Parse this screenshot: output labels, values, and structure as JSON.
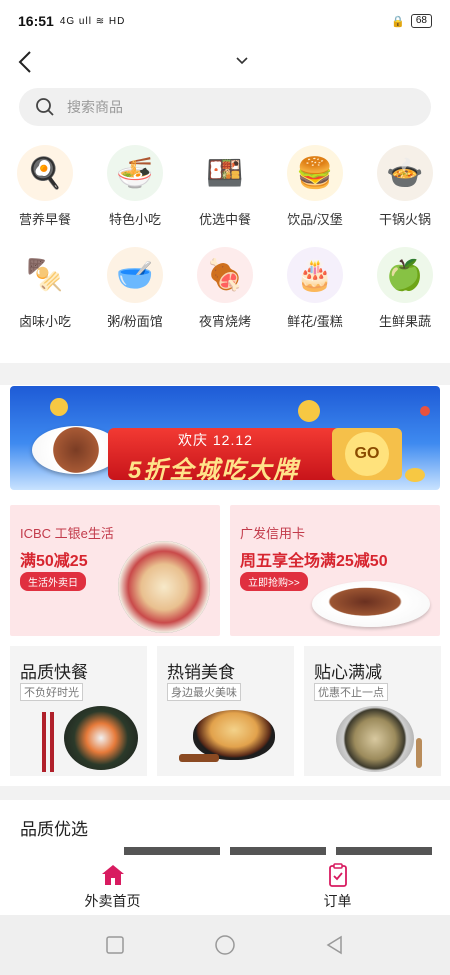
{
  "status": {
    "time": "16:51",
    "indicators": "4G ull  ≋ HD",
    "battery": "68"
  },
  "search": {
    "placeholder": "搜索商品"
  },
  "categories": [
    {
      "label": "营养早餐",
      "icon": "breakfast-icon",
      "glyph": "🍳",
      "bg": "#fff4e5"
    },
    {
      "label": "特色小吃",
      "icon": "noodle-bowl-icon",
      "glyph": "🍜",
      "bg": "#eef7ee"
    },
    {
      "label": "优选中餐",
      "icon": "chinese-meal-icon",
      "glyph": "🍱",
      "bg": "#fff"
    },
    {
      "label": "饮品/汉堡",
      "icon": "burger-drink-icon",
      "glyph": "🍔",
      "bg": "#fff6e0"
    },
    {
      "label": "干锅火锅",
      "icon": "hotpot-icon",
      "glyph": "🍲",
      "bg": "#f6f0e8"
    },
    {
      "label": "卤味小吃",
      "icon": "skewer-icon",
      "glyph": "🍢",
      "bg": "#fff"
    },
    {
      "label": "粥/粉面馆",
      "icon": "porridge-bowl-icon",
      "glyph": "🥣",
      "bg": "#fdf2e4"
    },
    {
      "label": "夜宵烧烤",
      "icon": "bbq-party-icon",
      "glyph": "🍖",
      "bg": "#fdecec"
    },
    {
      "label": "鲜花/蛋糕",
      "icon": "cake-icon",
      "glyph": "🎂",
      "bg": "#f5f0fb"
    },
    {
      "label": "生鲜果蔬",
      "icon": "fruit-icon",
      "glyph": "🍏",
      "bg": "#eef8ea"
    }
  ],
  "banner": {
    "small_text": "欢庆 12.12",
    "big_text": "5折全城吃大牌",
    "go_label": "GO"
  },
  "promos": [
    {
      "sub": "ICBC 工银e生活",
      "title": "满50减25",
      "button": "生活外卖日"
    },
    {
      "sub": "广发信用卡",
      "title": "周五享全场满25减50",
      "button": "立即抢购>>"
    }
  ],
  "features": [
    {
      "title": "品质快餐",
      "tag": "不负好时光"
    },
    {
      "title": "热销美食",
      "tag": "身边最火美味"
    },
    {
      "title": "贴心满减",
      "tag": "优惠不止一点"
    }
  ],
  "section": {
    "title": "品质优选"
  },
  "tabs": [
    {
      "label": "外卖首页"
    },
    {
      "label": "订单"
    }
  ],
  "colors": {
    "accent": "#d81b60",
    "promo_bg": "#fde6e8",
    "promo_red": "#d7252f"
  }
}
